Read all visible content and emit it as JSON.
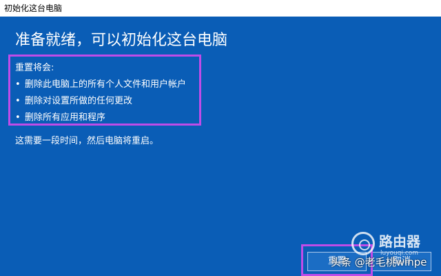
{
  "window": {
    "title": "初始化这台电脑"
  },
  "main": {
    "heading": "准备就绪，可以初始化这台电脑",
    "reset_intro": "重置将会:",
    "reset_items": [
      "删除此电脑上的所有个人文件和用户帐户",
      "删除对设置所做的任何更改",
      "删除所有应用和程序"
    ],
    "bullet": "•",
    "note": "这需要一段时间，然后电脑将重启。"
  },
  "buttons": {
    "reset_label": "重置",
    "cancel_label": "取消"
  },
  "watermark": {
    "brand": "路由器",
    "brand_sub": "luyouqi.com",
    "credit": "头条 @老毛桃winpe"
  },
  "colors": {
    "background": "#0a5db6",
    "highlight": "#c04ce8",
    "text": "#ffffff"
  }
}
